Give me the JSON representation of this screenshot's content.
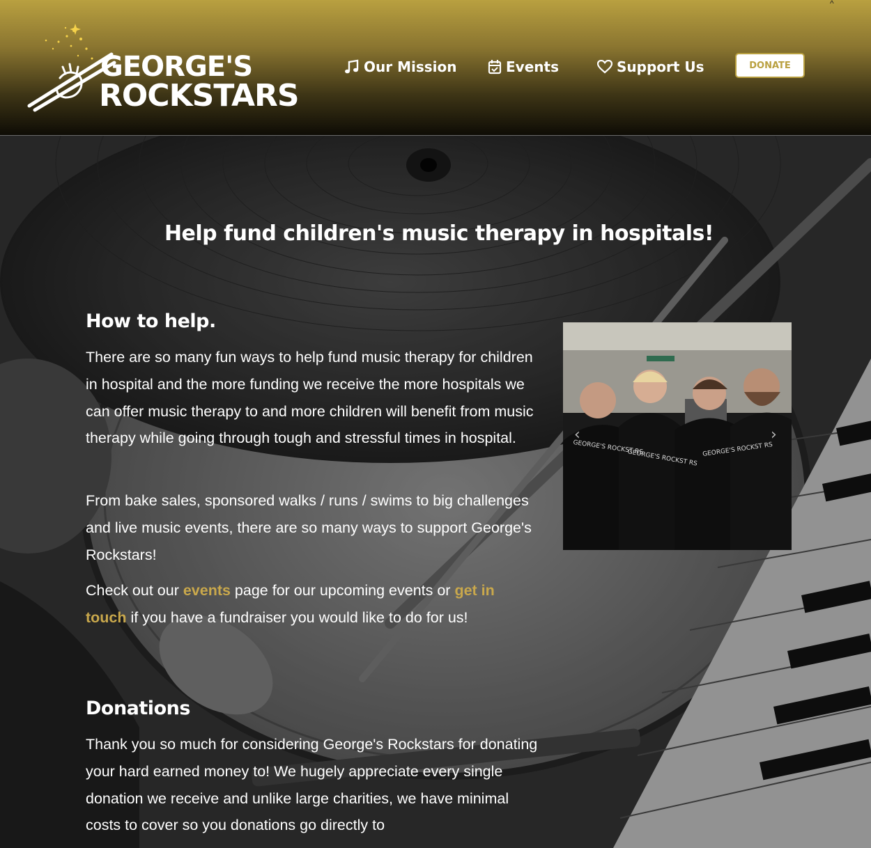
{
  "header": {
    "caret": "^",
    "logo": {
      "line1": "GEORGE'S",
      "line2": "ROCKSTARS"
    },
    "nav": [
      {
        "label": "Our Mission",
        "icon": "music-note-icon"
      },
      {
        "label": "Events",
        "icon": "calendar-check-icon"
      },
      {
        "label": "Support Us",
        "icon": "heart-icon"
      }
    ],
    "donate_label": "DONATE"
  },
  "hero": {
    "title": "Help fund children's music therapy in hospitals!"
  },
  "how_to_help": {
    "heading": "How to help.",
    "para1": "There are so many fun ways to help fund music therapy for children in hospital and the more funding we receive the more hospitals we can offer music therapy to and more children will benefit from music therapy while going through tough and stressful times in hospital.",
    "para2": "From bake sales, sponsored walks / runs / swims to big challenges and live music events, there are so many ways to support George's Rockstars!",
    "para3_before": "Check out our ",
    "para3_link1": "events",
    "para3_middle": " page for our upcoming events or ",
    "para3_link2": "get in touch",
    "para3_after": " if you have a fundraiser you would like to do for us!"
  },
  "donations": {
    "heading": "Donations",
    "para": "Thank you so much for considering George's Rockstars for donating your hard earned money to! We hugely appreciate every single donation we receive and unlike large charities, we have minimal costs to cover so you donations go directly to"
  },
  "carousel": {
    "prev_icon": "chevron-left-icon",
    "next_icon": "chevron-right-icon",
    "shirt_text": [
      "GEORGE'S ROCKST RS",
      "GEORGE'S ROCKST RS",
      "GEORGE'S ROCKST RS"
    ]
  },
  "colors": {
    "accent": "#b9a040",
    "link": "#c9a84c",
    "header_top": "#b9a040",
    "header_bottom": "#0e0c05"
  }
}
